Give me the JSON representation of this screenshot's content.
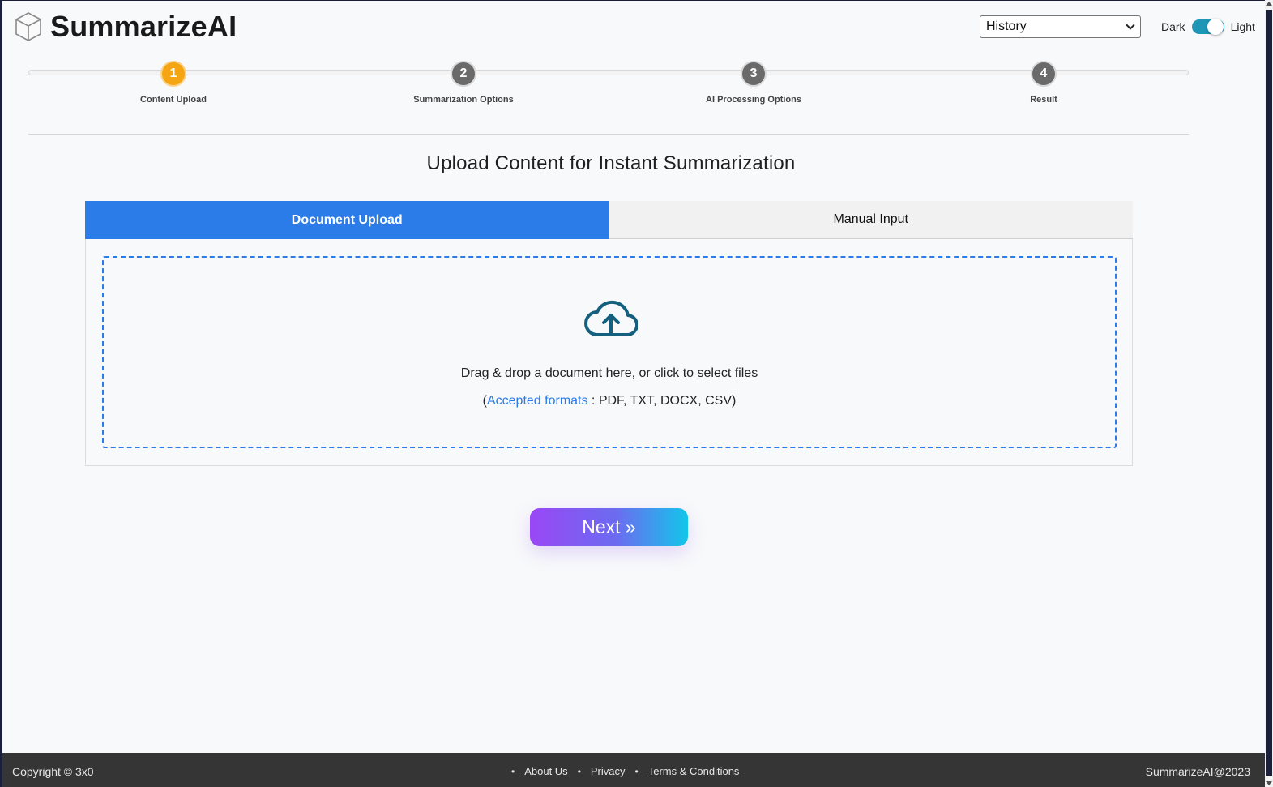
{
  "brand": {
    "name": "SummarizeAI",
    "logo_icon": "cube-icon"
  },
  "history_select": {
    "value": "History"
  },
  "theme_toggle": {
    "left_label": "Dark",
    "right_label": "Light",
    "state": "on"
  },
  "steps": [
    {
      "number": "1",
      "label": "Content Upload",
      "active": true
    },
    {
      "number": "2",
      "label": "Summarization Options",
      "active": false
    },
    {
      "number": "3",
      "label": "AI Processing Options",
      "active": false
    },
    {
      "number": "4",
      "label": "Result",
      "active": false
    }
  ],
  "page_title": "Upload Content for Instant Summarization",
  "tabs": [
    {
      "label": "Document Upload",
      "active": true
    },
    {
      "label": "Manual Input",
      "active": false
    }
  ],
  "dropzone": {
    "icon": "cloud-upload-icon",
    "instruction": "Drag & drop a document here, or click to select files",
    "formats_open": "(",
    "formats_link": "Accepted formats",
    "formats_rest": " : PDF, TXT, DOCX, CSV)"
  },
  "next_button": {
    "label": "Next »"
  },
  "footer": {
    "copyright": "Copyright © 3x0",
    "links": [
      "About Us",
      "Privacy",
      "Terms & Conditions"
    ],
    "right_text": "SummarizeAI@2023"
  },
  "colors": {
    "accent_blue": "#2b7ce9",
    "active_step": "#f5a511",
    "inactive_step": "#6a6a6a",
    "toggle": "#1e97b6",
    "footer_bg": "#353535"
  }
}
